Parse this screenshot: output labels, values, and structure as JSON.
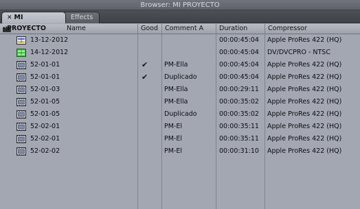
{
  "window": {
    "title": "Browser: MI PROYECTO"
  },
  "tabs": [
    {
      "label": "MI PROYECTO",
      "close": "✕"
    },
    {
      "label": "Effects"
    }
  ],
  "columns": [
    "Name",
    "Good",
    "Comment A",
    "Duration",
    "Compressor"
  ],
  "rows": [
    {
      "icon": "sequence-icon",
      "name": "13-12-2012",
      "good": "",
      "comment": "",
      "duration": "00:00:45:04",
      "compressor": "Apple ProRes 422 (HQ)"
    },
    {
      "icon": "sequence-green-icon",
      "name": "14-12-2012",
      "good": "",
      "comment": "",
      "duration": "00:00:45:04",
      "compressor": "DV/DVCPRO - NTSC"
    },
    {
      "icon": "clip-icon",
      "name": "52-01-01",
      "good": "✔",
      "comment": "PM-Ella",
      "duration": "00:00:45:04",
      "compressor": "Apple ProRes 422 (HQ)"
    },
    {
      "icon": "clip-icon",
      "name": "52-01-01",
      "good": "✔",
      "comment": "Duplicado",
      "duration": "00:00:45:04",
      "compressor": "Apple ProRes 422 (HQ)"
    },
    {
      "icon": "clip-icon",
      "name": "52-01-03",
      "good": "",
      "comment": "PM-Ella",
      "duration": "00:00:29:11",
      "compressor": "Apple ProRes 422 (HQ)"
    },
    {
      "icon": "clip-icon",
      "name": "52-01-05",
      "good": "",
      "comment": "PM-Ella",
      "duration": "00:00:35:02",
      "compressor": "Apple ProRes 422 (HQ)"
    },
    {
      "icon": "clip-icon",
      "name": "52-01-05",
      "good": "",
      "comment": "Duplicado",
      "duration": "00:00:35:02",
      "compressor": "Apple ProRes 422 (HQ)"
    },
    {
      "icon": "clip-icon",
      "name": "52-02-01",
      "good": "",
      "comment": "PM-El",
      "duration": "00:00:35:11",
      "compressor": "Apple ProRes 422 (HQ)"
    },
    {
      "icon": "clip-icon",
      "name": "52-02-01",
      "good": "",
      "comment": "PM-El",
      "duration": "00:00:35:11",
      "compressor": "Apple ProRes 422 (HQ)"
    },
    {
      "icon": "clip-icon",
      "name": "52-02-02",
      "good": "",
      "comment": "PM-El",
      "duration": "00:00:31:10",
      "compressor": "Apple ProRes 422 (HQ)"
    }
  ]
}
